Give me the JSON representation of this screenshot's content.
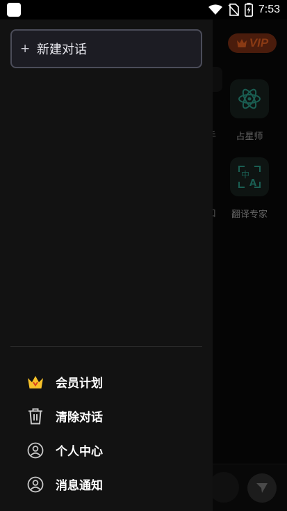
{
  "status_bar": {
    "time": "7:53",
    "icons": [
      "app-icon",
      "wifi-icon",
      "no-sim-icon",
      "battery-charging-icon"
    ]
  },
  "background": {
    "vip_badge": "VIP",
    "tiles": [
      {
        "label": "占星师",
        "icon": "atom-icon"
      },
      {
        "label": "翻译专家",
        "icon": "translate-icon"
      }
    ],
    "partial_labels": [
      "手",
      "口"
    ]
  },
  "drawer": {
    "new_chat_icon": "plus-icon",
    "new_chat_label": "新建对话",
    "menu": [
      {
        "label": "会员计划",
        "icon": "crown-icon"
      },
      {
        "label": "清除对话",
        "icon": "trash-icon"
      },
      {
        "label": "个人中心",
        "icon": "user-circle-icon"
      },
      {
        "label": "消息通知",
        "icon": "user-circle-icon"
      }
    ]
  },
  "colors": {
    "drawer_bg": "#121212",
    "button_border": "#4b4c59",
    "crown_yellow": "#f6c12a",
    "vip_orange": "#8a3a14"
  }
}
